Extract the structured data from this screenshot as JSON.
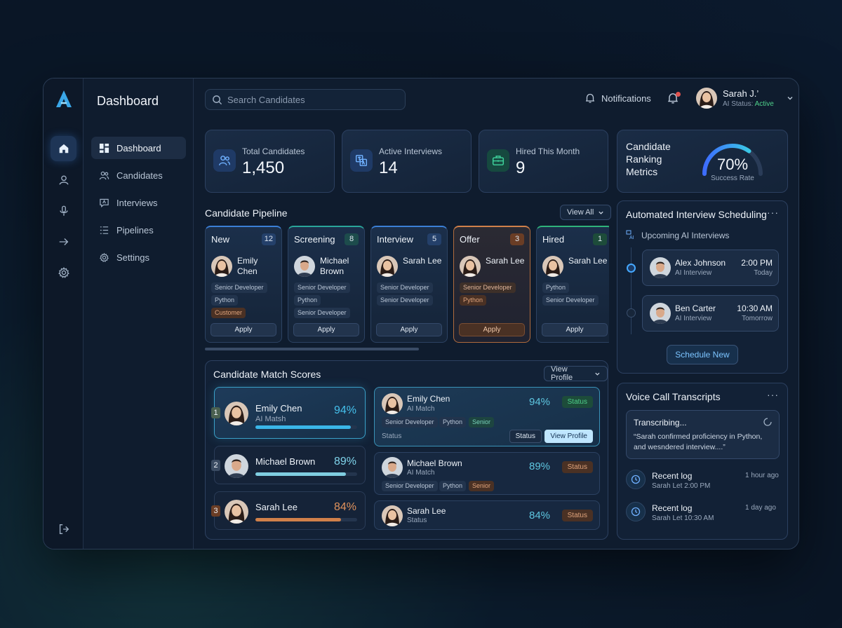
{
  "app": {
    "page_title": "Dashboard",
    "brand_color": "#3aa7e8"
  },
  "nav": {
    "items": [
      {
        "label": "Dashboard",
        "icon": "grid-icon"
      },
      {
        "label": "Candidates",
        "icon": "users-icon"
      },
      {
        "label": "Interviews",
        "icon": "chat-icon"
      },
      {
        "label": "Pipelines",
        "icon": "list-icon"
      },
      {
        "label": "Settings",
        "icon": "gear-icon"
      }
    ]
  },
  "header": {
    "search_placeholder": "Search Candidates",
    "notifications_label": "Notifications",
    "user_name": "Sarah J.’",
    "ai_status_label": "AI Status:",
    "ai_status_value": "Active"
  },
  "stats": [
    {
      "label": "Total Candidates",
      "value": "1,450",
      "icon": "users-icon",
      "color": "#3d7be0"
    },
    {
      "label": "Active Interviews",
      "value": "14",
      "icon": "translate-icon",
      "color": "#3d7be0"
    },
    {
      "label": "Hired This Month",
      "value": "9",
      "icon": "briefcase-icon",
      "color": "#2bb38a"
    }
  ],
  "ranking": {
    "title": "Candidate Ranking Metrics",
    "value": "70%",
    "caption": "Success Rate",
    "progress": 0.7
  },
  "pipeline": {
    "title": "Candidate Pipeline",
    "view_all": "View All",
    "columns": [
      {
        "name": "New",
        "count": "12",
        "person": "Emily Chen",
        "tags": [
          "Senior Developer",
          "Python",
          "Customer"
        ],
        "action": "Apply",
        "accent": "#3b7fd6"
      },
      {
        "name": "Screening",
        "count": "8",
        "person": "Michael Brown",
        "tags": [
          "Senior Developer",
          "Python",
          "Senior Developer"
        ],
        "action": "Apply",
        "accent": "#2aa59a"
      },
      {
        "name": "Interview",
        "count": "5",
        "person": "Sarah Lee",
        "tags": [
          "Senior Developer",
          "Senior Developer"
        ],
        "action": "Apply",
        "accent": "#3b7fd6"
      },
      {
        "name": "Offer",
        "count": "3",
        "person": "Sarah Lee",
        "tags": [
          "Senior Developer",
          "Python"
        ],
        "action": "Apply",
        "accent": "#d0804a"
      },
      {
        "name": "Hired",
        "count": "1",
        "person": "Sarah Lee",
        "tags": [
          "Python",
          "Senior Developer"
        ],
        "action": "Apply",
        "accent": "#2fb37a"
      }
    ]
  },
  "match": {
    "title": "Candidate Match Scores",
    "view_profile": "View Profile",
    "ranks": [
      {
        "rank": "1",
        "name": "Emily Chen",
        "sub": "AI Matsh",
        "score": "94%",
        "fill": 0.94,
        "color": "#3ab6e8"
      },
      {
        "rank": "2",
        "name": "Michael Brown",
        "sub": "",
        "score": "89%",
        "fill": 0.89,
        "color": "#7fcde0"
      },
      {
        "rank": "3",
        "name": "Sarah Lee",
        "sub": "",
        "score": "84%",
        "fill": 0.84,
        "color": "#d0804a"
      }
    ],
    "details": [
      {
        "name": "Emily Chen",
        "sub": "AI Match",
        "score": "94%",
        "status": "Status",
        "tags": [
          "Senior Developer",
          "Python",
          "Senior"
        ],
        "footer": "Status",
        "btn_status": "Status",
        "btn_view": "View Profile"
      },
      {
        "name": "Michael Brown",
        "sub": "AI Match",
        "score": "89%",
        "status": "Status",
        "tags": [
          "Senior Developer",
          "Python",
          "Senior"
        ]
      },
      {
        "name": "Sarah Lee",
        "sub": "Status",
        "score": "84%",
        "status": "Status"
      }
    ]
  },
  "scheduling": {
    "title": "Automated Interview Scheduling",
    "upcoming": "Upcoming AI Interviews",
    "items": [
      {
        "name": "Alex Johnson",
        "type": "AI Interview",
        "time": "2:00 PM",
        "day": "Today"
      },
      {
        "name": "Ben Carter",
        "type": "AI Interview",
        "time": "10:30 AM",
        "day": "Tomorrow"
      }
    ],
    "button": "Schedule New"
  },
  "voice": {
    "title": "Voice Call Transcripts",
    "transcribing": "Transcribing...",
    "quote": "“Sarah confirmed proficiency in Python, and wesndered interview....”",
    "logs": [
      {
        "title": "Recent log",
        "sub": "Sarah Let 2:00 PM",
        "when": "1 hour ago"
      },
      {
        "title": "Recent log",
        "sub": "Sarah Let 10:30 AM",
        "when": "1 day ago"
      }
    ]
  }
}
